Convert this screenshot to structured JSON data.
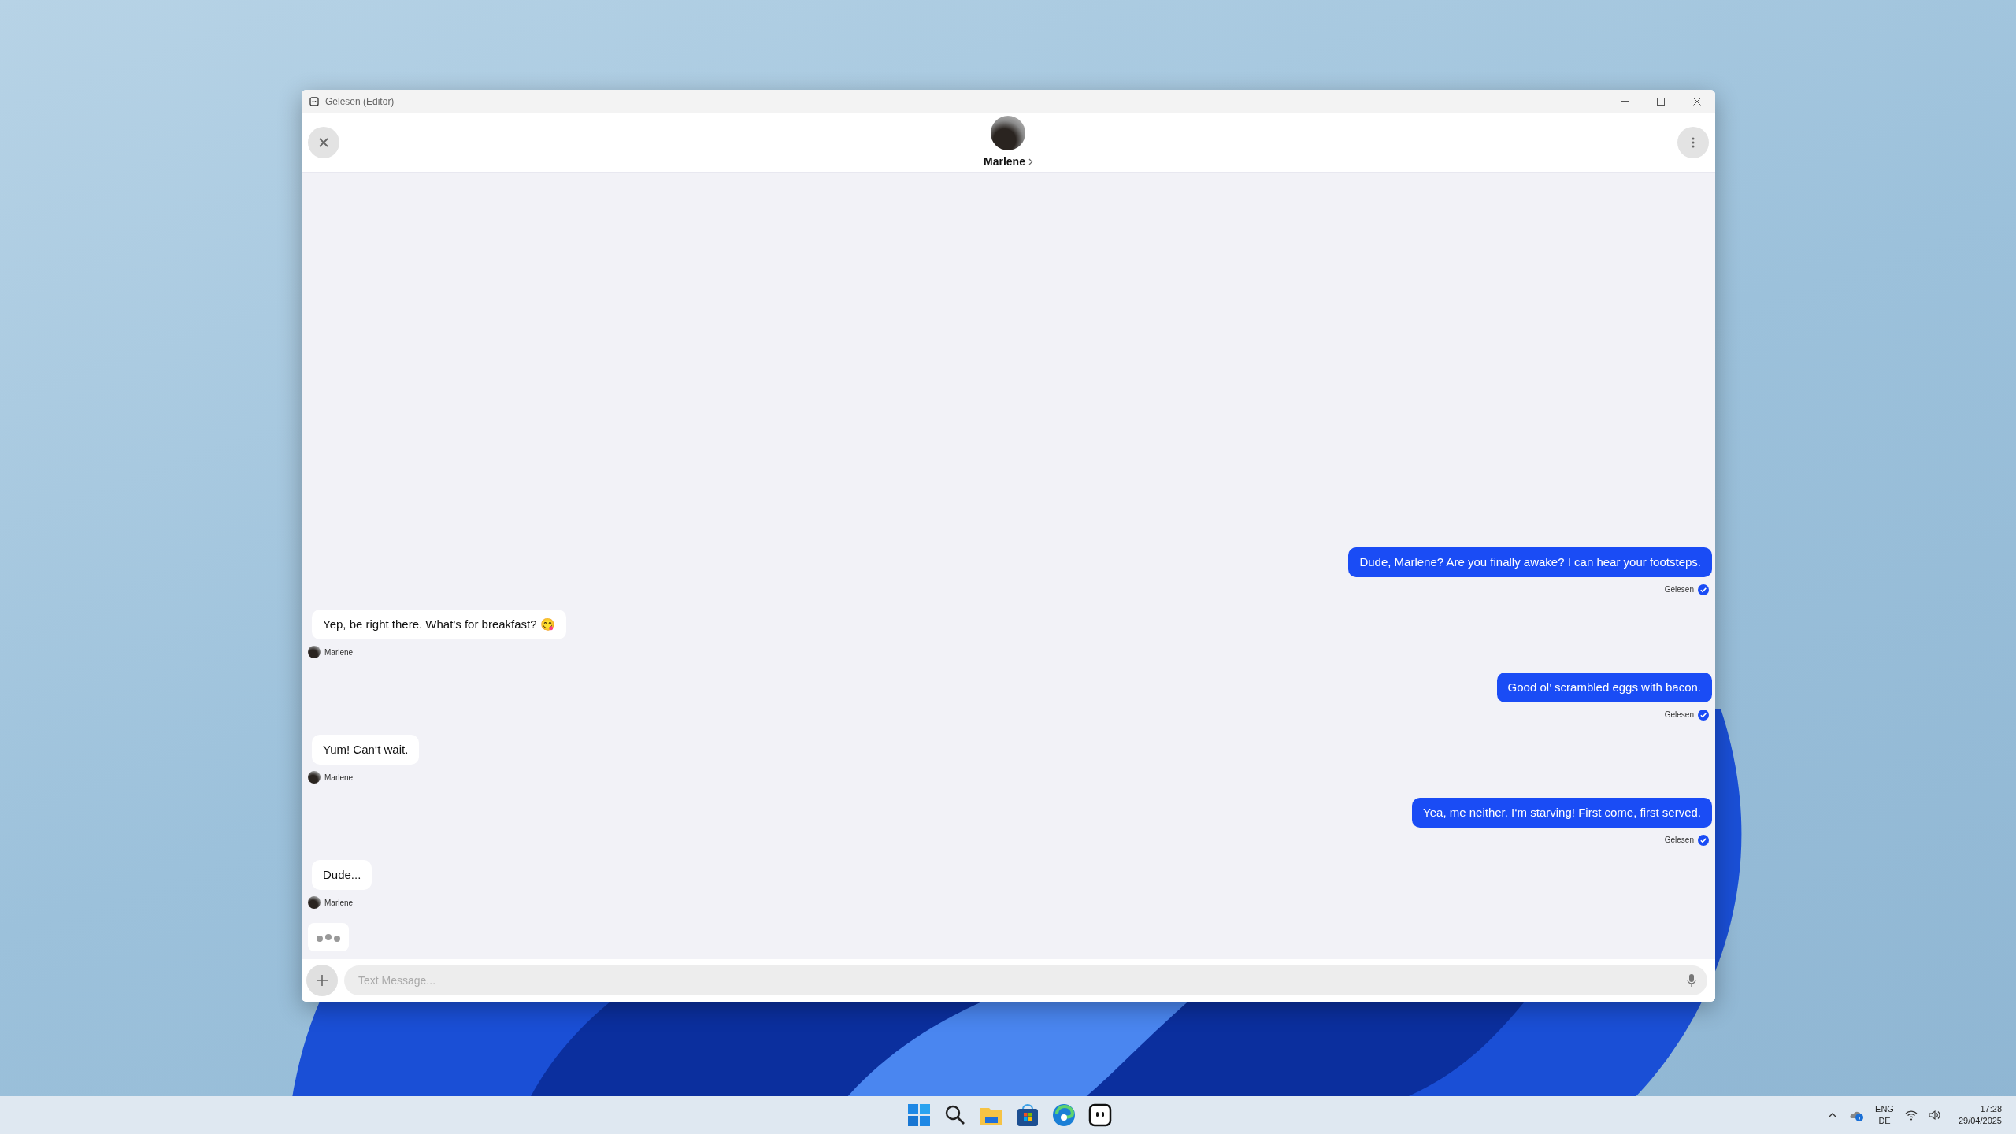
{
  "window": {
    "title": "Gelesen (Editor)"
  },
  "header": {
    "contact_name": "Marlene"
  },
  "messages": [
    {
      "kind": "sent",
      "text": "Dude, Marlene? Are you finally awake? I can hear your footsteps.",
      "status": "Gelesen",
      "read": true
    },
    {
      "kind": "received",
      "text": "Yep, be right there. What's for breakfast? 😋",
      "sender": "Marlene"
    },
    {
      "kind": "sent",
      "text": "Good ol’ scrambled eggs with bacon.",
      "status": "Gelesen",
      "read": true
    },
    {
      "kind": "received",
      "text": "Yum! Can‘t wait.",
      "sender": "Marlene"
    },
    {
      "kind": "sent",
      "text": "Yea, me neither. I‘m starving! First come, first served.",
      "status": "Gelesen",
      "read": true
    },
    {
      "kind": "received",
      "text": "Dude...",
      "sender": "Marlene"
    }
  ],
  "typing_indicator": true,
  "composer": {
    "placeholder": "Text Message..."
  },
  "taskbar": {
    "language": "ENG",
    "layout": "DE",
    "time": "17:28",
    "date": "29/04/2025"
  }
}
